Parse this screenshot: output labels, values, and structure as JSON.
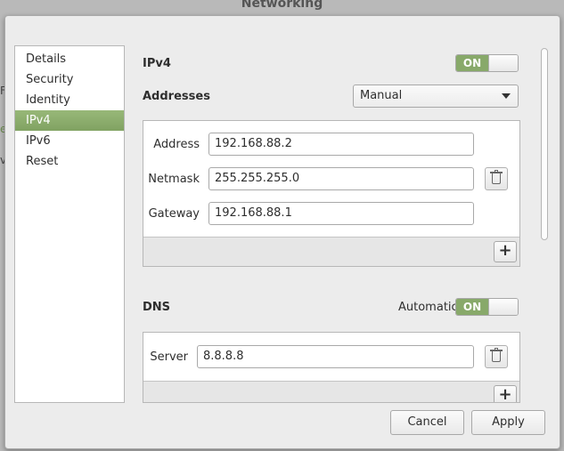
{
  "window": {
    "title": "Networking"
  },
  "sidebar": {
    "items": [
      {
        "label": "Details"
      },
      {
        "label": "Security"
      },
      {
        "label": "Identity"
      },
      {
        "label": "IPv4",
        "active": true
      },
      {
        "label": "IPv6"
      },
      {
        "label": "Reset"
      }
    ]
  },
  "ipv4": {
    "heading": "IPv4",
    "toggle_label": "ON",
    "addresses_label": "Addresses",
    "method_value": "Manual",
    "address_label": "Address",
    "address_value": "192.168.88.2",
    "netmask_label": "Netmask",
    "netmask_value": "255.255.255.0",
    "gateway_label": "Gateway",
    "gateway_value": "192.168.88.1",
    "add_label": "+"
  },
  "dns": {
    "heading": "DNS",
    "automatic_label": "Automatic",
    "toggle_label": "ON",
    "server_label": "Server",
    "server_value": "8.8.8.8",
    "add_label": "+"
  },
  "footer": {
    "cancel_label": "Cancel",
    "apply_label": "Apply"
  },
  "colors": {
    "accent": "#88a96a"
  }
}
